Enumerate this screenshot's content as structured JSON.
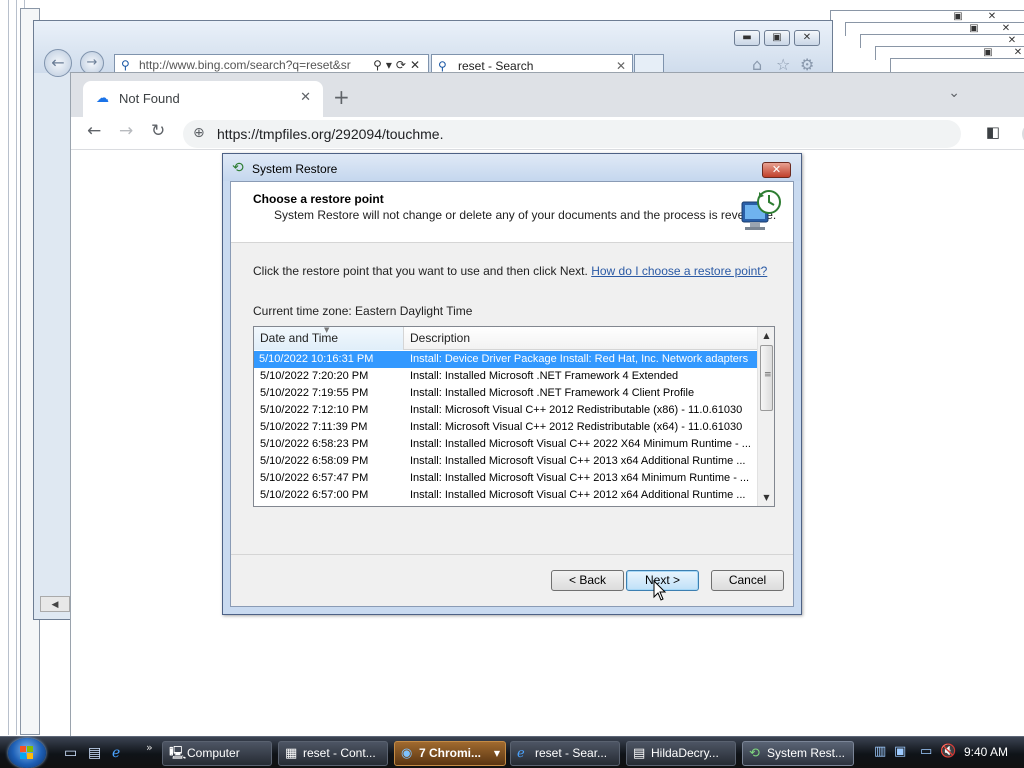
{
  "ie_window": {
    "address": "http://www.bing.com/search?q=reset&sr",
    "tab_title": "reset - Search"
  },
  "browser": {
    "tab_title": "Not Found",
    "url": "https://tmpfiles.org/292094/touchme."
  },
  "dialog": {
    "title": "System Restore",
    "heading": "Choose a restore point",
    "subheading": "System Restore will not change or delete any of your documents and the process is reversible.",
    "intro": "Click the restore point that you want to use and then click Next.",
    "help_link": "How do I choose a restore point?",
    "timezone": "Current time zone: Eastern Daylight Time",
    "columns": [
      "Date and Time",
      "Description"
    ],
    "rows": [
      {
        "date": "5/10/2022 10:16:31 PM",
        "desc": "Install: Device Driver Package Install: Red Hat, Inc. Network adapters",
        "selected": true
      },
      {
        "date": "5/10/2022 7:20:20 PM",
        "desc": "Install: Installed Microsoft .NET Framework 4 Extended"
      },
      {
        "date": "5/10/2022 7:19:55 PM",
        "desc": "Install: Installed Microsoft .NET Framework 4 Client Profile"
      },
      {
        "date": "5/10/2022 7:12:10 PM",
        "desc": "Install: Microsoft Visual C++ 2012 Redistributable (x86) - 11.0.61030"
      },
      {
        "date": "5/10/2022 7:11:39 PM",
        "desc": "Install: Microsoft Visual C++ 2012 Redistributable (x64) - 11.0.61030"
      },
      {
        "date": "5/10/2022 6:58:23 PM",
        "desc": "Install: Installed Microsoft Visual C++ 2022 X64 Minimum Runtime - ..."
      },
      {
        "date": "5/10/2022 6:58:09 PM",
        "desc": "Install: Installed Microsoft Visual C++ 2013 x64 Additional Runtime ..."
      },
      {
        "date": "5/10/2022 6:57:47 PM",
        "desc": "Install: Installed Microsoft Visual C++ 2013 x64 Minimum Runtime - ..."
      },
      {
        "date": "5/10/2022 6:57:00 PM",
        "desc": "Install: Installed Microsoft Visual C++ 2012 x64 Additional Runtime ..."
      }
    ],
    "buttons": {
      "back": "< Back",
      "next": "Next >",
      "cancel": "Cancel"
    },
    "selected_color": "#3399ff"
  },
  "taskbar": {
    "items": [
      {
        "label": "Computer",
        "icon": "computer-icon"
      },
      {
        "label": "reset - Cont...",
        "icon": "control-panel-icon"
      },
      {
        "label": "7  Chromi...",
        "icon": "chromium-icon"
      },
      {
        "label": "reset - Sear...",
        "icon": "ie-icon"
      },
      {
        "label": "HildaDecry...",
        "icon": "document-icon"
      },
      {
        "label": "System Rest...",
        "icon": "system-restore-icon"
      }
    ],
    "clock": "9:40 AM"
  }
}
